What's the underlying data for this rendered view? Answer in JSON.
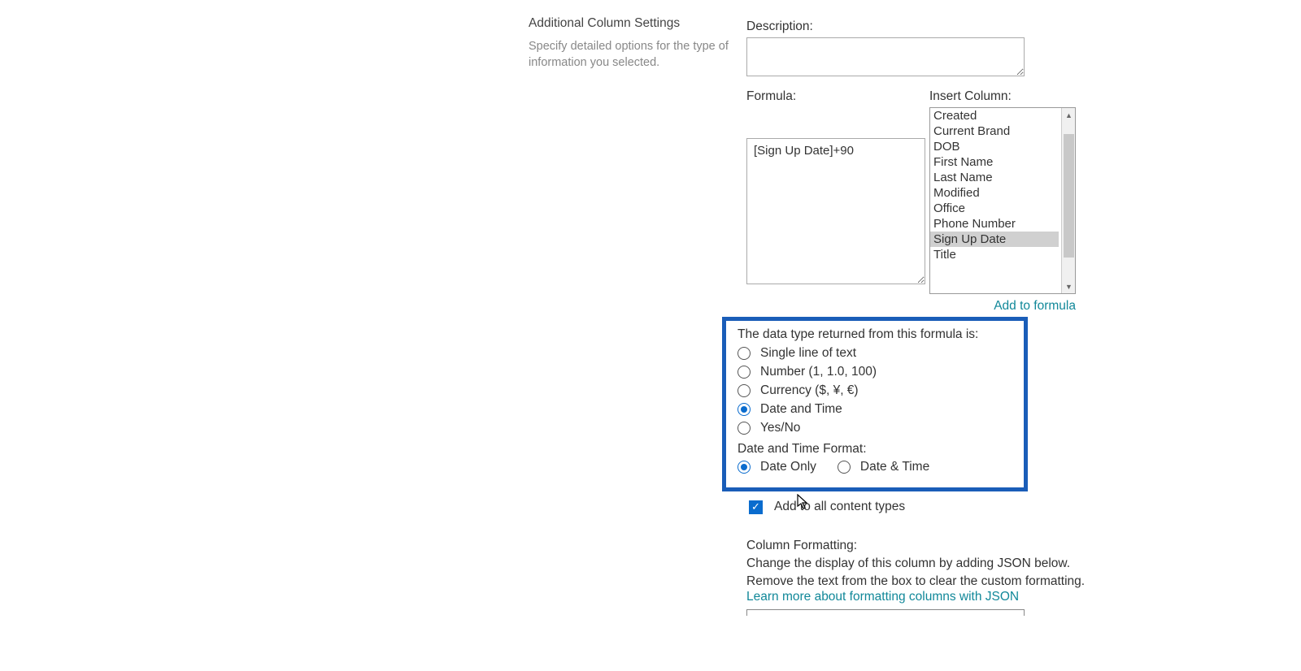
{
  "leftCol": {
    "title": "Additional Column Settings",
    "desc": "Specify detailed options for the type of information you selected."
  },
  "description": {
    "label": "Description:",
    "value": ""
  },
  "formula": {
    "label": "Formula:",
    "value": "[Sign Up Date]+90"
  },
  "insertColumn": {
    "label": "Insert Column:",
    "options": [
      "Created",
      "Current Brand",
      "DOB",
      "First Name",
      "Last Name",
      "Modified",
      "Office",
      "Phone Number",
      "Sign Up Date",
      "Title"
    ],
    "selected": "Sign Up Date"
  },
  "addToFormula": "Add to formula",
  "dataType": {
    "label": "The data type returned from this formula is:",
    "options": {
      "single": "Single line of text",
      "number": "Number (1, 1.0, 100)",
      "currency": "Currency ($, ¥, €)",
      "datetime": "Date and Time",
      "yesno": "Yes/No"
    },
    "selected": "datetime"
  },
  "dtFormat": {
    "label": "Date and Time Format:",
    "dateOnly": "Date Only",
    "dateAndTime": "Date & Time",
    "selected": "dateOnly"
  },
  "addContentTypes": {
    "label": "Add to all content types",
    "checked": true
  },
  "columnFormatting": {
    "title": "Column Formatting:",
    "line1": "Change the display of this column by adding JSON below.",
    "line2": "Remove the text from the box to clear the custom formatting.",
    "link": "Learn more about formatting columns with JSON"
  }
}
